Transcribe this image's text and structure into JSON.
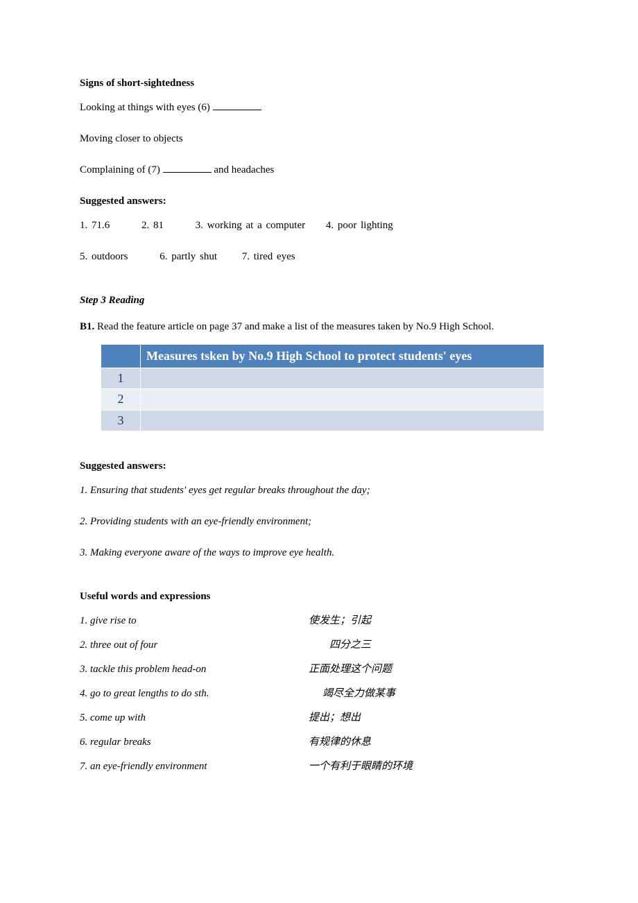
{
  "signs": {
    "heading": "Signs of short-sightedness",
    "line1_pre": "Looking at things with eyes (6) ",
    "line2": "Moving closer to objects",
    "line3_pre": "Complaining of (7) ",
    "line3_post": " and headaches"
  },
  "suggested1": {
    "heading": "Suggested answers:",
    "a1": "1. 71.6",
    "a2": "2. 81",
    "a3": "3. working at a computer",
    "a4": "4. poor lighting",
    "a5": "5. outdoors",
    "a6": "6. partly shut",
    "a7": "7. tired eyes"
  },
  "step3": {
    "heading": "Step 3   Reading",
    "b1_label": "B1.",
    "b1_text": " Read the feature article on page 37 and make a list of the measures taken by No.9 High School."
  },
  "table": {
    "header": "Measures tsken by No.9 High School to protect students' eyes",
    "rows": [
      {
        "n": "1",
        "v": ""
      },
      {
        "n": "2",
        "v": ""
      },
      {
        "n": "3",
        "v": ""
      }
    ]
  },
  "suggested2": {
    "heading": "Suggested answers:",
    "items": [
      "1. Ensuring that students' eyes get regular breaks throughout the day;",
      "2. Providing students with an eye-friendly environment;",
      "3. Making everyone aware of the ways to improve eye health."
    ]
  },
  "useful": {
    "heading": "Useful words and expressions",
    "items": [
      {
        "en": "1. give rise to",
        "cn": "使发生；引起"
      },
      {
        "en": "2. three out of four",
        "cn": "四分之三"
      },
      {
        "en": "3. tackle this problem head-on",
        "cn": "正面处理这个问题"
      },
      {
        "en": "4. go to great lengths to do sth.",
        "cn": "竭尽全力做某事"
      },
      {
        "en": "5. come up with",
        "cn": "提出；想出"
      },
      {
        "en": "6. regular breaks",
        "cn": "有规律的休息"
      },
      {
        "en": "7. an eye-friendly environment",
        "cn": "一个有利于眼睛的环境"
      }
    ]
  }
}
